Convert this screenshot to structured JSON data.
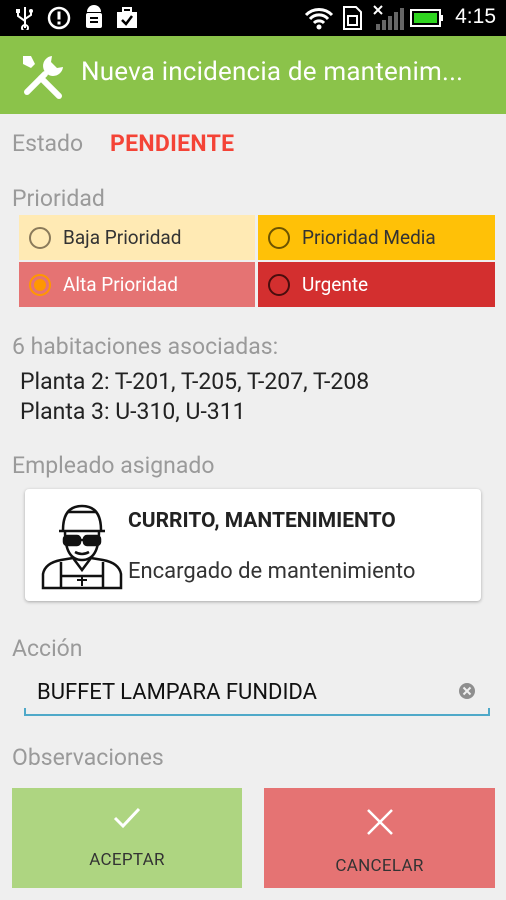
{
  "status_bar": {
    "time": "4:15",
    "icons": [
      "usb-icon",
      "alert-icon",
      "android-debug-icon",
      "briefcase-check-icon",
      "wifi-icon",
      "sim-icon",
      "signal-icon",
      "battery-icon"
    ]
  },
  "app_bar": {
    "title": "Nueva incidencia de mantenim...",
    "icon": "tools-icon",
    "color": "#8bc34a"
  },
  "estado": {
    "label": "Estado",
    "value": "PENDIENTE",
    "value_color": "#f44336"
  },
  "prioridad": {
    "label": "Prioridad",
    "options": [
      {
        "label": "Baja Prioridad",
        "checked": false,
        "bg": "#ffeab4"
      },
      {
        "label": "Prioridad Media",
        "checked": false,
        "bg": "#ffc107"
      },
      {
        "label": "Alta Prioridad",
        "checked": true,
        "bg": "#e57373"
      },
      {
        "label": "Urgente",
        "checked": false,
        "bg": "#d32f2f"
      }
    ]
  },
  "habitaciones": {
    "label": "6 habitaciones asociadas:",
    "lines": [
      "Planta 2: T-201, T-205, T-207, T-208",
      "Planta 3: U-310, U-311"
    ]
  },
  "empleado": {
    "label": "Empleado asignado",
    "name": "CURRITO, MANTENIMIENTO",
    "role": "Encargado de mantenimiento",
    "avatar_icon": "worker-avatar-icon"
  },
  "accion": {
    "label": "Acción",
    "value": "BUFFET LAMPARA FUNDIDA"
  },
  "observaciones": {
    "label": "Observaciones"
  },
  "buttons": {
    "accept": {
      "label": "ACEPTAR",
      "icon": "check-icon",
      "color": "#aed581"
    },
    "cancel": {
      "label": "CANCELAR",
      "icon": "close-icon",
      "color": "#e57373"
    }
  }
}
